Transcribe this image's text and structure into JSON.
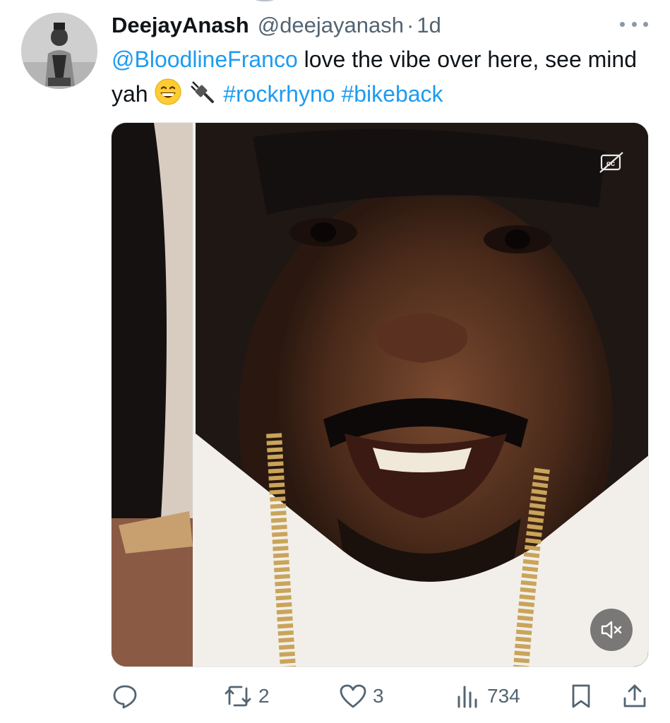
{
  "tweet": {
    "display_name": "DeejayAnash",
    "handle": "@deejayanash",
    "separator": "·",
    "time": "1d",
    "mention": "@BloodlineFranco",
    "text_part1": " love the vibe over here, see mind yah ",
    "hashtag1": "#rockrhyno",
    "hashtag2": "#bikeback",
    "emojis": [
      "grinning-face",
      "electric-plug"
    ]
  },
  "actions": {
    "reply_count": "",
    "retweet_count": "2",
    "like_count": "3",
    "view_count": "734"
  },
  "colors": {
    "link": "#1d9bf0",
    "secondary_text": "#536471",
    "primary_text": "#0f1419",
    "background": "#ffffff"
  },
  "icons": [
    "more-icon",
    "reply-icon",
    "retweet-icon",
    "like-icon",
    "views-icon",
    "bookmark-icon",
    "share-icon",
    "captions-icon",
    "mute-icon"
  ]
}
